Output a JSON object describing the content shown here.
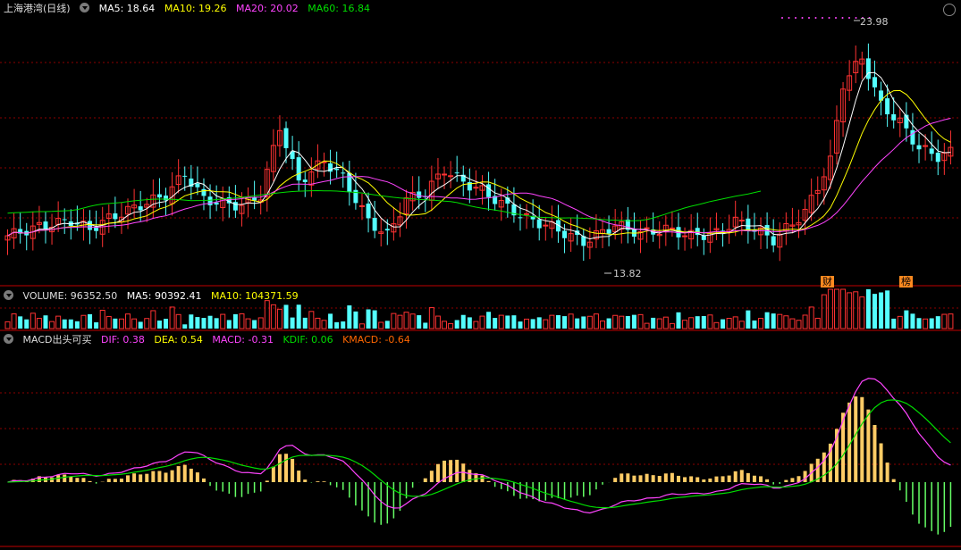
{
  "header": {
    "title": "上海港湾(日线)",
    "ma5": "MA5: 18.64",
    "ma10": "MA10: 19.26",
    "ma20": "MA20: 20.02",
    "ma60": "MA60: 16.84"
  },
  "volume_header": {
    "name": "VOLUME: 96352.50",
    "ma5": "MA5: 90392.41",
    "ma10": "MA10: 104371.59"
  },
  "macd_header": {
    "name": "MACD出头可买",
    "dif": "DIF: 0.38",
    "dea": "DEA: 0.54",
    "macd": "MACD: -0.31",
    "kdif": "KDIF: 0.06",
    "kmacd": "KMACD: -0.64"
  },
  "annotations": {
    "high_label": "23.98",
    "low_label": "13.82",
    "tag1": "财",
    "tag2": "榜"
  },
  "colors": {
    "up": "#ff3232",
    "down": "#54ffff",
    "ma5": "#ffffff",
    "ma10": "#ffff00",
    "ma20": "#ff44ff",
    "ma60": "#00dd00",
    "grid": "#8b0000",
    "dif": "#ff44ff",
    "dea": "#00dd00"
  },
  "chart_data": {
    "type": "candlestick",
    "y_range": [
      13.0,
      24.6
    ],
    "anchors": [
      [
        0,
        14.5
      ],
      [
        6,
        15.0
      ],
      [
        10,
        15.2
      ],
      [
        13,
        14.8
      ],
      [
        16,
        15.3
      ],
      [
        20,
        15.8
      ],
      [
        25,
        16.4
      ],
      [
        28,
        17.4
      ],
      [
        31,
        16.2
      ],
      [
        34,
        16.0
      ],
      [
        37,
        15.9
      ],
      [
        40,
        16.4
      ],
      [
        43,
        19.6
      ],
      [
        46,
        17.0
      ],
      [
        50,
        18.0
      ],
      [
        53,
        17.2
      ],
      [
        57,
        15.2
      ],
      [
        60,
        14.5
      ],
      [
        63,
        16.2
      ],
      [
        66,
        16.5
      ],
      [
        69,
        17.6
      ],
      [
        72,
        17.0
      ],
      [
        75,
        16.6
      ],
      [
        78,
        16.0
      ],
      [
        82,
        15.3
      ],
      [
        86,
        14.9
      ],
      [
        91,
        14.2
      ],
      [
        96,
        15.0
      ],
      [
        100,
        14.6
      ],
      [
        104,
        14.8
      ],
      [
        108,
        14.5
      ],
      [
        112,
        14.6
      ],
      [
        115,
        15.2
      ],
      [
        118,
        14.8
      ],
      [
        121,
        14.3
      ],
      [
        126,
        15.6
      ],
      [
        130,
        18.0
      ],
      [
        132,
        21.6
      ],
      [
        135,
        22.8
      ],
      [
        138,
        20.6
      ],
      [
        141,
        19.8
      ],
      [
        144,
        18.6
      ],
      [
        147,
        18.2
      ],
      [
        149,
        18.4
      ]
    ]
  }
}
